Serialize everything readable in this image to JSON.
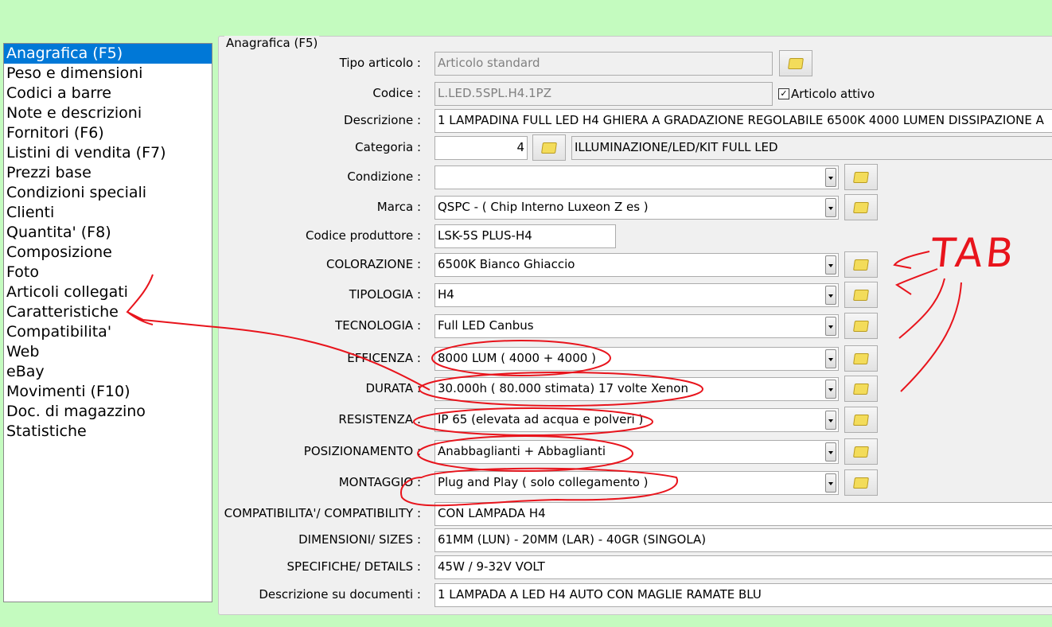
{
  "nav": {
    "items": [
      "Anagrafica (F5)",
      "Peso e dimensioni",
      "Codici a barre",
      "Note e descrizioni",
      "Fornitori (F6)",
      "Listini di vendita (F7)",
      "Prezzi base",
      "Condizioni speciali",
      "Clienti",
      "Quantita' (F8)",
      "Composizione",
      "Foto",
      "Articoli collegati",
      "Caratteristiche",
      "Compatibilita'",
      "Web",
      "eBay",
      "Movimenti (F10)",
      "Doc. di magazzino",
      "Statistiche"
    ],
    "selected": 0
  },
  "group_title": "Anagrafica (F5)",
  "form": {
    "tipo_articolo": {
      "label": "Tipo articolo :",
      "value": "Articolo standard"
    },
    "codice": {
      "label": "Codice :",
      "value": "L.LED.5SPL.H4.1PZ"
    },
    "articolo_attivo": {
      "label": "Articolo attivo",
      "checked": true,
      "mark": "✓"
    },
    "descrizione": {
      "label": "Descrizione :",
      "value": "1 LAMPADINA FULL LED H4 GHIERA A GRADAZIONE REGOLABILE 6500K 4000 LUMEN DISSIPAZIONE A"
    },
    "categoria": {
      "label": "Categoria :",
      "value": "4",
      "path": "ILLUMINAZIONE/LED/KIT FULL LED"
    },
    "condizione": {
      "label": "Condizione :",
      "value": ""
    },
    "marca": {
      "label": "Marca :",
      "value": "QSPC - ( Chip Interno Luxeon Z es )"
    },
    "codice_produttore": {
      "label": "Codice produttore :",
      "value": "LSK-5S PLUS-H4"
    },
    "colorazione": {
      "label": "COLORAZIONE :",
      "value": "6500K Bianco Ghiaccio"
    },
    "tipologia": {
      "label": "TIPOLOGIA :",
      "value": "H4"
    },
    "tecnologia": {
      "label": "TECNOLOGIA :",
      "value": "Full LED Canbus"
    },
    "efficenza": {
      "label": "EFFICENZA :",
      "value": "8000 LUM ( 4000 + 4000 )"
    },
    "durata": {
      "label": "DURATA :",
      "value": "30.000h ( 80.000 stimata) 17 volte Xenon"
    },
    "resistenza": {
      "label": "RESISTENZA :",
      "value": "IP 65 (elevata ad acqua e polveri )"
    },
    "posizionamento": {
      "label": "POSIZIONAMENTO :",
      "value": "Anabbaglianti + Abbaglianti"
    },
    "montaggio": {
      "label": "MONTAGGIO :",
      "value": "Plug and Play ( solo collegamento )"
    },
    "compatibilita": {
      "label": "COMPATIBILITA'/ COMPATIBILITY :",
      "value": "CON LAMPADA H4"
    },
    "dimensioni": {
      "label": "DIMENSIONI/ SIZES :",
      "value": "61MM (LUN) - 20MM (LAR) - 40GR (SINGOLA)"
    },
    "specifiche": {
      "label": "SPECIFICHE/ DETAILS :",
      "value": "45W / 9-32V VOLT"
    },
    "descrizione_documenti": {
      "label": "Descrizione su documenti :",
      "value": "1 LAMPADA A LED H4 AUTO CON MAGLIE RAMATE BLU"
    }
  },
  "annotation": {
    "handwritten_text": "TAB",
    "color": "#e8141c"
  },
  "colors": {
    "background": "#c4fbbf",
    "selection": "#0078d7"
  }
}
